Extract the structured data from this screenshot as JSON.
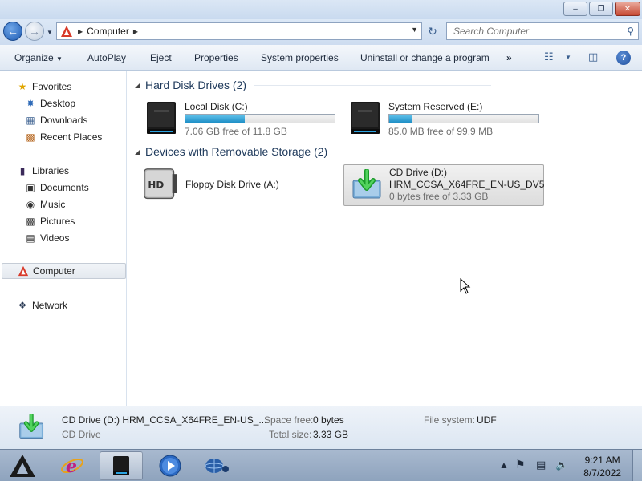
{
  "window": {
    "minimize_glyph": "–",
    "maximize_glyph": "❐",
    "close_glyph": "✕"
  },
  "address_bar": {
    "breadcrumb": "Computer",
    "search_placeholder": "Search Computer"
  },
  "toolbar": {
    "organize": "Organize",
    "autoplay": "AutoPlay",
    "eject": "Eject",
    "properties": "Properties",
    "system_properties": "System properties",
    "uninstall": "Uninstall or change a program",
    "more": "»"
  },
  "nav_pane": {
    "favorites": "Favorites",
    "desktop": "Desktop",
    "downloads": "Downloads",
    "recent_places": "Recent Places",
    "libraries": "Libraries",
    "documents": "Documents",
    "music": "Music",
    "pictures": "Pictures",
    "videos": "Videos",
    "computer": "Computer",
    "network": "Network"
  },
  "groups": {
    "hard_disks": "Hard Disk Drives (2)",
    "removable": "Devices with Removable Storage (2)"
  },
  "drives": {
    "local_c": {
      "name": "Local Disk (C:)",
      "free": "7.06 GB free of 11.8 GB",
      "used_fraction": 0.4
    },
    "system_e": {
      "name": "System Reserved (E:)",
      "free": "85.0 MB free of 99.9 MB",
      "used_fraction": 0.15
    },
    "floppy_a": {
      "name": "Floppy Disk Drive (A:)"
    },
    "cd_d": {
      "name": "CD Drive (D:)",
      "label": "HRM_CCSA_X64FRE_EN-US_DV5",
      "free": "0 bytes free of 3.33 GB"
    }
  },
  "details": {
    "title": "CD Drive (D:) HRM_CCSA_X64FRE_EN-US_...",
    "type": "CD Drive",
    "space_free_label": "Space free:",
    "space_free_value": "0 bytes",
    "total_size_label": "Total size:",
    "total_size_value": "3.33 GB",
    "file_system_label": "File system:",
    "file_system_value": "UDF"
  },
  "taskbar": {
    "time": "9:21 AM",
    "date": "8/7/2022"
  },
  "colors": {
    "accent_blue": "#1f8fc6",
    "group_header": "#1e395b"
  }
}
